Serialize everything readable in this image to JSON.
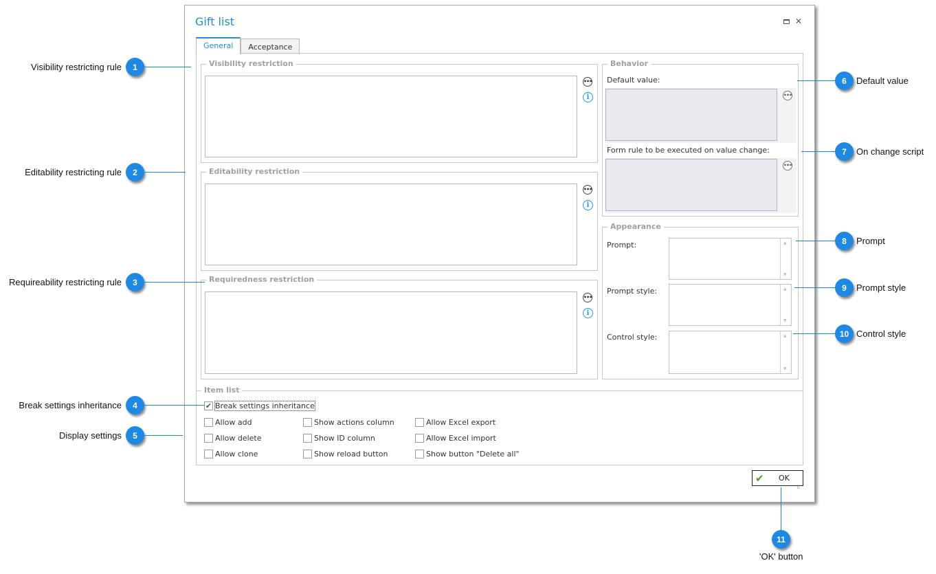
{
  "dialog": {
    "title": "Gift list",
    "window_buttons": {
      "maximize_icon": "maximize-icon",
      "close_icon": "close-icon",
      "close_glyph": "✕"
    },
    "tabs": [
      {
        "label": "General",
        "active": true
      },
      {
        "label": "Acceptance",
        "active": false
      }
    ],
    "groups": {
      "visibility": {
        "legend": "Visibility restriction"
      },
      "editability": {
        "legend": "Editability restriction"
      },
      "requiredness": {
        "legend": "Requiredness restriction"
      },
      "behavior": {
        "legend": "Behavior",
        "default_value_label": "Default value:",
        "on_change_label": "Form rule to be executed on value change:"
      },
      "appearance": {
        "legend": "Appearance",
        "prompt_label": "Prompt:",
        "prompt_style_label": "Prompt style:",
        "control_style_label": "Control style:"
      },
      "item_list": {
        "legend": "Item list",
        "break_inheritance": {
          "label": "Break settings inheritance",
          "checked": true
        },
        "options": [
          {
            "label": "Allow add",
            "checked": false
          },
          {
            "label": "Allow delete",
            "checked": false
          },
          {
            "label": "Allow clone",
            "checked": false
          },
          {
            "label": "Show actions column",
            "checked": false
          },
          {
            "label": "Show ID column",
            "checked": false
          },
          {
            "label": "Show reload button",
            "checked": false
          },
          {
            "label": "Allow Excel export",
            "checked": false
          },
          {
            "label": "Allow Excel import",
            "checked": false
          },
          {
            "label": "Show button \"Delete all\"",
            "checked": false
          }
        ]
      }
    },
    "ok_button": {
      "label": "OK",
      "icon": "checkmark-icon"
    },
    "icons": {
      "ellipsis": "•••",
      "info": "i",
      "check": "✔",
      "up": "▲",
      "down": "▼",
      "grip": "⠿"
    }
  },
  "callouts": [
    {
      "number": "1",
      "text": "Visibility restricting rule"
    },
    {
      "number": "2",
      "text": "Editability restricting rule"
    },
    {
      "number": "3",
      "text": "Requireability restricting rule"
    },
    {
      "number": "4",
      "text": "Break settings inheritance"
    },
    {
      "number": "5",
      "text": "Display settings"
    },
    {
      "number": "6",
      "text": "Default value"
    },
    {
      "number": "7",
      "text": "On change script"
    },
    {
      "number": "8",
      "text": "Prompt"
    },
    {
      "number": "9",
      "text": "Prompt style"
    },
    {
      "number": "10",
      "text": "Control style"
    },
    {
      "number": "11",
      "text": "'OK' button"
    }
  ],
  "colors": {
    "accent": "#1b8fd8",
    "badge": "#1e88e5",
    "ok_check": "#4d9b22",
    "legend_text": "#a0a0a0",
    "grey_field": "#e9eaef"
  }
}
